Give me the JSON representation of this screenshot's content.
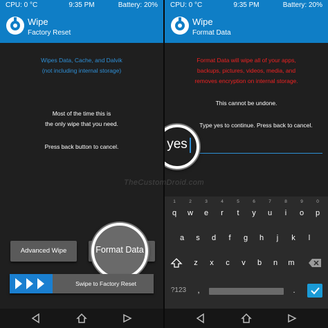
{
  "left": {
    "status": {
      "cpu": "CPU: 0 °C",
      "time": "9:35 PM",
      "battery": "Battery: 20%"
    },
    "header": {
      "title": "Wipe",
      "subtitle": "Factory Reset"
    },
    "info_blue": [
      "Wipes Data, Cache, and Dalvik",
      "(not including internal storage)"
    ],
    "info_white": [
      "Most of the time this is",
      "the only wipe that you need."
    ],
    "cancel_text": "Press back button to cancel.",
    "advanced_wipe_label": "Advanced Wipe",
    "format_data_label": "Format Data",
    "swipe_label": "Swipe to Factory Reset"
  },
  "right": {
    "status": {
      "cpu": "CPU: 0 °C",
      "time": "9:35 PM",
      "battery": "Battery: 20%"
    },
    "header": {
      "title": "Wipe",
      "subtitle": "Format Data"
    },
    "warning_lines": [
      "Format Data will wipe all of your apps,",
      "backups, pictures, videos, media, and",
      "removes encryption on internal storage."
    ],
    "undone_text": "This cannot be undone.",
    "prompt_text": "Type yes to continue.  Press back to cancel.",
    "input_value": "yes",
    "keyboard": {
      "row1": [
        "q",
        "w",
        "e",
        "r",
        "t",
        "y",
        "u",
        "i",
        "o",
        "p"
      ],
      "row1_hints": [
        "1",
        "2",
        "3",
        "4",
        "5",
        "6",
        "7",
        "8",
        "9",
        "0"
      ],
      "row2": [
        "a",
        "s",
        "d",
        "f",
        "g",
        "h",
        "j",
        "k",
        "l"
      ],
      "row3": [
        "z",
        "x",
        "c",
        "v",
        "b",
        "n",
        "m"
      ],
      "symbols_label": "?123",
      "comma": ",",
      "period": "."
    }
  },
  "watermark": "TheCustomDroid.com",
  "colors": {
    "accent": "#0f7ec6",
    "warning": "#ee2222",
    "info": "#2e8fd6"
  }
}
